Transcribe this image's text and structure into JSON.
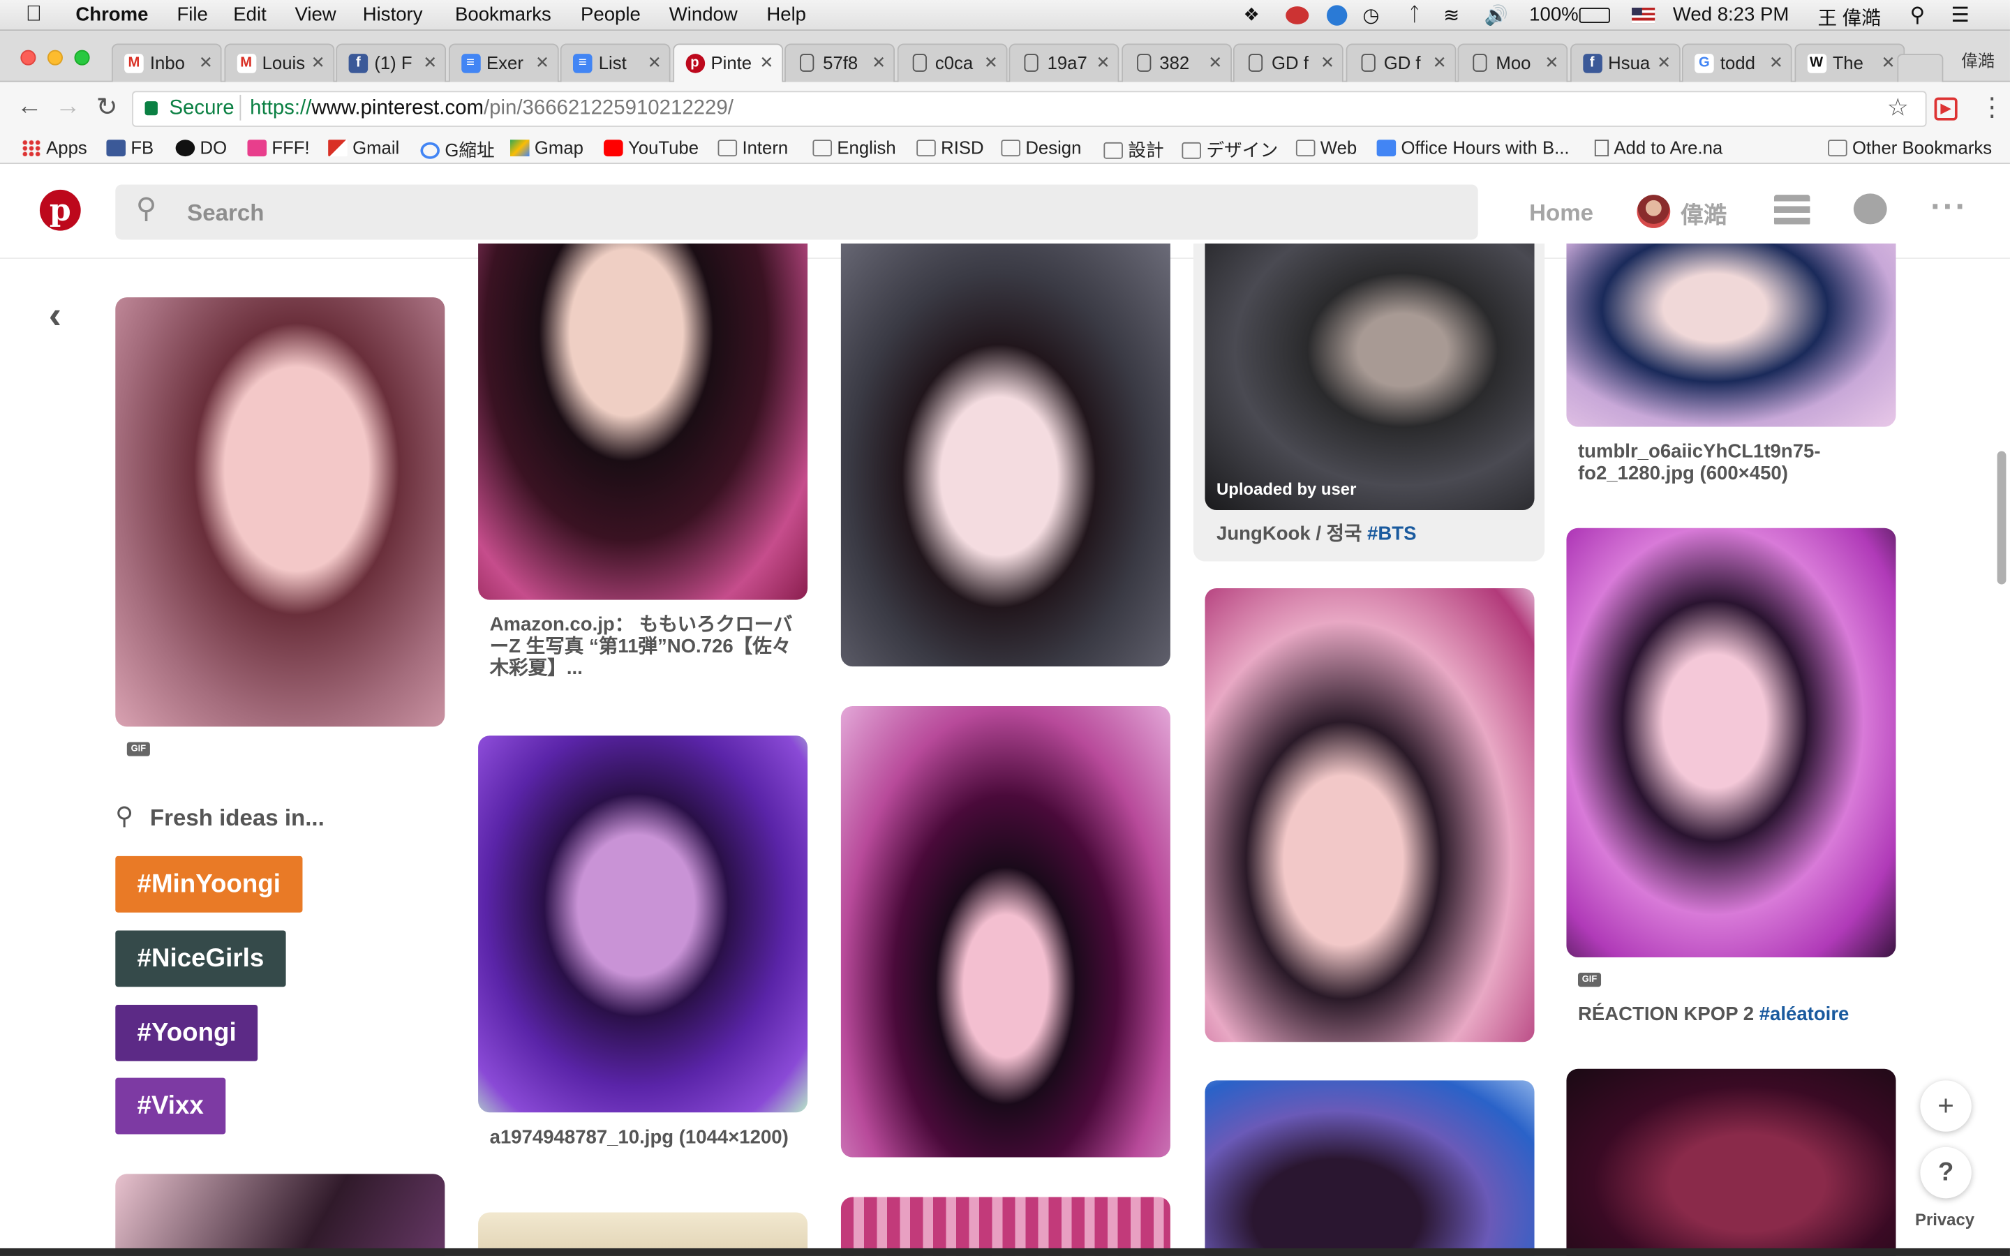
{
  "menubar": {
    "app": "Chrome",
    "menus": [
      "File",
      "Edit",
      "View",
      "History",
      "Bookmarks",
      "People",
      "Window",
      "Help"
    ],
    "battery": "100%",
    "clock": "Wed 8:23 PM",
    "user": "王 偉澔"
  },
  "tabs": [
    {
      "title": "Inbo",
      "icon": "gmail-icon"
    },
    {
      "title": "Louis",
      "icon": "gmail-icon"
    },
    {
      "title": "(1) F",
      "icon": "facebook-icon"
    },
    {
      "title": "Exer",
      "icon": "docs-icon"
    },
    {
      "title": "List",
      "icon": "docs-icon"
    },
    {
      "title": "Pinte",
      "icon": "pinterest-icon"
    },
    {
      "title": "57f8",
      "icon": "page-icon"
    },
    {
      "title": "c0ca",
      "icon": "page-icon"
    },
    {
      "title": "19a7",
      "icon": "page-icon"
    },
    {
      "title": "382",
      "icon": "page-icon"
    },
    {
      "title": "GD f",
      "icon": "page-icon"
    },
    {
      "title": "GD f",
      "icon": "page-icon"
    },
    {
      "title": "Moo",
      "icon": "page-icon"
    },
    {
      "title": "Hsua",
      "icon": "facebook-icon"
    },
    {
      "title": "todd",
      "icon": "google-icon"
    },
    {
      "title": "The",
      "icon": "wikipedia-icon"
    }
  ],
  "profile_name": "偉澔",
  "address": {
    "secure_label": "Secure",
    "url_prefix": "https://",
    "url_domain": "www.pinterest.com",
    "url_path": "/pin/366621225910212229/"
  },
  "bookmarks": [
    {
      "label": "Apps",
      "icon": "apps-grid-icon"
    },
    {
      "label": "FB",
      "icon": "facebook-icon"
    },
    {
      "label": "DO",
      "icon": "do-icon"
    },
    {
      "label": "FFF!",
      "icon": "heart-icon"
    },
    {
      "label": "Gmail",
      "icon": "gmail-icon"
    },
    {
      "label": "G縮址",
      "icon": "google-icon"
    },
    {
      "label": "Gmap",
      "icon": "maps-icon"
    },
    {
      "label": "YouTube",
      "icon": "youtube-icon"
    },
    {
      "label": "Intern",
      "icon": "folder-icon"
    },
    {
      "label": "English",
      "icon": "folder-icon"
    },
    {
      "label": "RISD",
      "icon": "folder-icon"
    },
    {
      "label": "Design",
      "icon": "folder-icon"
    },
    {
      "label": "設計",
      "icon": "folder-icon"
    },
    {
      "label": "デザイン",
      "icon": "folder-icon"
    },
    {
      "label": "Web",
      "icon": "folder-icon"
    },
    {
      "label": "Office Hours with B...",
      "icon": "docs-icon"
    },
    {
      "label": "Add to Are.na",
      "icon": "page-icon"
    }
  ],
  "other_bookmarks": "Other Bookmarks",
  "pinterest": {
    "search_placeholder": "Search",
    "home": "Home",
    "user": "偉澔"
  },
  "sidebar": {
    "gif_badge": "GIF",
    "fresh_ideas": "Fresh ideas in...",
    "tags": [
      {
        "label": "#MinYoongi",
        "color": "#e97a26"
      },
      {
        "label": "#NiceGirls",
        "color": "#354a4a"
      },
      {
        "label": "#Yoongi",
        "color": "#5c2a86"
      },
      {
        "label": "#Vixx",
        "color": "#7d3aa3"
      }
    ]
  },
  "pins": {
    "col1_caption": "Amazon.co.jp： ももいろクローバーZ 生写真 “第11弾”NO.726【佐々木彩夏】...",
    "col1b_caption": "a1974948787_10.jpg (1044×1200)",
    "col3_overlay": "Uploaded by user",
    "col3_caption_text": "JungKook / 정국 ",
    "col3_caption_tag": "#BTS",
    "col4_caption": "tumblr_o6aiicYhCL1t9n75-fo2_1280.jpg (600×450)",
    "col4b_gif": "GIF",
    "col4b_caption_text": "RÉACTION KPOP 2 ",
    "col4b_caption_tag": "#aléatoire"
  },
  "floating": {
    "plus": "+",
    "help": "?",
    "privacy": "Privacy"
  }
}
